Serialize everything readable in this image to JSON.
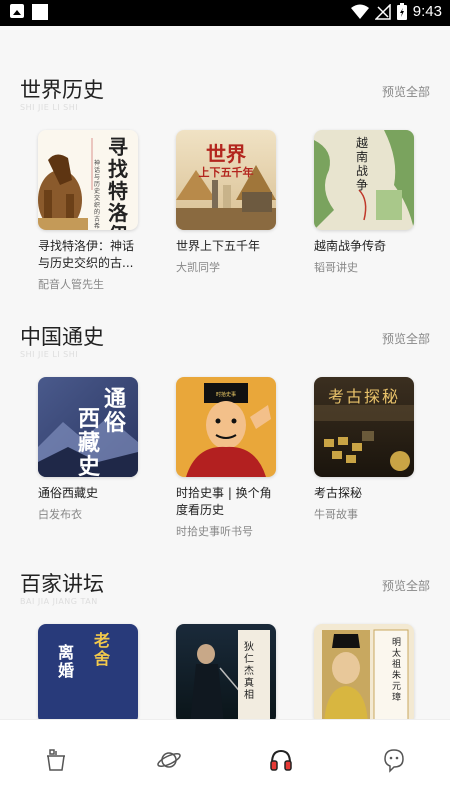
{
  "status_bar": {
    "time": "9:43",
    "icons": [
      "image-icon",
      "square-icon",
      "wifi-icon",
      "signal-icon",
      "battery-icon"
    ]
  },
  "sections": [
    {
      "title": "世界历史",
      "pinyin": "SHI JIE LI SHI",
      "more": "预览全部",
      "books": [
        {
          "title": "寻找特洛伊：神话与历史交织的古...",
          "author": "配音人管先生",
          "cover_text": "寻找特洛伊",
          "cover_sub": "神话与历史交织的古希腊文明"
        },
        {
          "title": "世界上下五千年",
          "author": "大凯同学",
          "cover_text": "世界",
          "cover_sub": "上下五千年"
        },
        {
          "title": "越南战争传奇",
          "author": "韬哥讲史",
          "cover_text": "越南战争"
        }
      ]
    },
    {
      "title": "中国通史",
      "pinyin": "SHI JIE LI SHI",
      "more": "预览全部",
      "books": [
        {
          "title": "通俗西藏史",
          "author": "白发布衣",
          "cover_text": "通俗",
          "cover_sub": "西藏史"
        },
        {
          "title": "时拾史事 | 换个角度看历史",
          "author": "时拾史事听书号",
          "cover_text": "时拾史事"
        },
        {
          "title": "考古探秘",
          "author": "牛哥故事",
          "cover_text": "考古探秘"
        }
      ]
    },
    {
      "title": "百家讲坛",
      "pinyin": "BAI JIA JIANG TAN",
      "more": "预览全部",
      "books": [
        {
          "title": "",
          "author": "",
          "cover_text": "老舍",
          "cover_sub": "离婚"
        },
        {
          "title": "",
          "author": "",
          "cover_text": "狄仁杰真相"
        },
        {
          "title": "",
          "author": "",
          "cover_text": "明太祖朱元璋"
        }
      ]
    }
  ],
  "bottom_nav": [
    {
      "name": "home-pot-icon",
      "active": false
    },
    {
      "name": "planet-icon",
      "active": false
    },
    {
      "name": "headphones-icon",
      "active": true
    },
    {
      "name": "chat-face-icon",
      "active": false
    }
  ]
}
